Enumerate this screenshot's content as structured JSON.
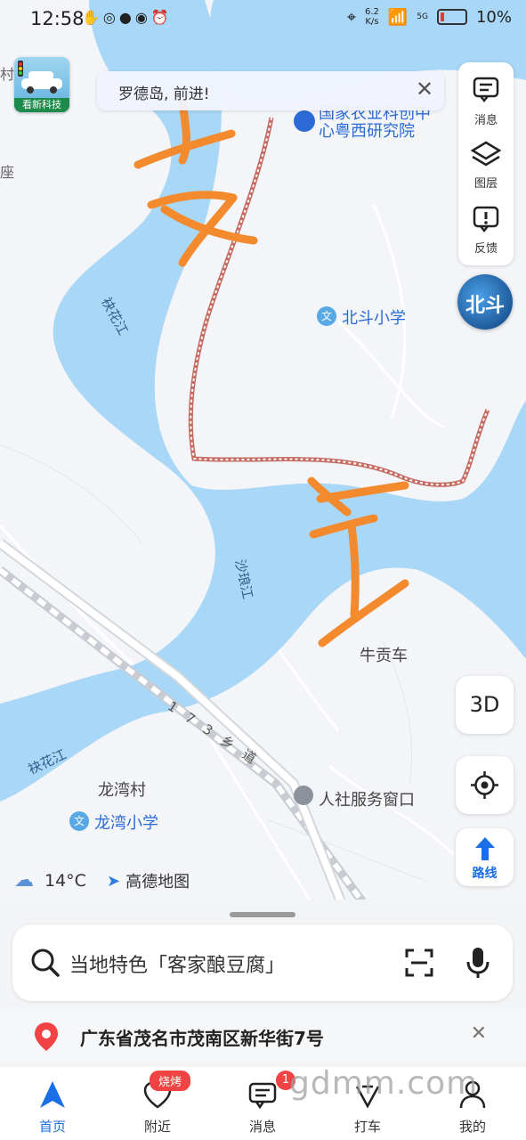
{
  "status_bar": {
    "time": "12:58",
    "net_speed_value": "6.2",
    "net_speed_unit": "K/s",
    "signal_label": "5G",
    "battery": "10%",
    "left_icons": [
      "hand-icon",
      "wechat-icon",
      "chat-icon",
      "eye-icon",
      "alarm-icon"
    ]
  },
  "map": {
    "logo_badge": "看新科技",
    "toast": {
      "text": "罗德岛, 前进!"
    },
    "side_panel": {
      "messages": "消息",
      "layers": "图层",
      "feedback": "反馈"
    },
    "beidou": "北斗",
    "partial_left_top": "村",
    "partial_left_mid": "座",
    "pois": {
      "institute_line1": "国家农业科创中",
      "institute_line2": "心粤西研究院",
      "school_beidou": "北斗小学",
      "niugongche": "牛贡车",
      "longwan_village": "龙湾村",
      "longwan_school": "龙湾小学",
      "social_service": "人社服务窗口"
    },
    "rivers": {
      "jiuhua_upper": "袂花江",
      "shalang": "沙琅江",
      "jiuhua_lower": "袂花江"
    },
    "road": "173乡道",
    "button_3d": "3D",
    "route_button": "路线",
    "weather": "14°C",
    "brand": "高德地图",
    "colors": {
      "water": "#a9d7f7",
      "land": "#f3f5f8",
      "stroke": "#f48a2e",
      "route": "#c56b62"
    }
  },
  "search": {
    "placeholder": "当地特色「客家酿豆腐」"
  },
  "address": {
    "text": "广东省茂名市茂南区新华街7号"
  },
  "tabs": [
    {
      "label": "首页"
    },
    {
      "label": "附近",
      "badge": "烧烤"
    },
    {
      "label": "消息",
      "badge": "1"
    },
    {
      "label": "打车"
    },
    {
      "label": "我的"
    }
  ],
  "watermark": "gdmm.com"
}
